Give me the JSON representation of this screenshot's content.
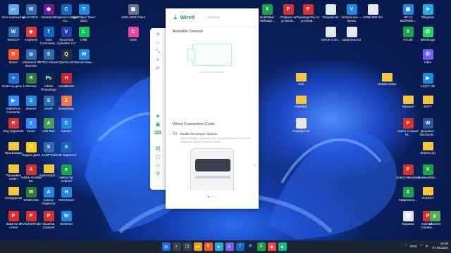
{
  "desktop": {
    "icons": [
      {
        "label": "Этот компьютер",
        "color": "#5aa9e6",
        "glyph": "▭"
      },
      {
        "label": "WinSCP",
        "color": "#2b6cb0",
        "glyph": "W"
      },
      {
        "label": "Brave",
        "color": "#fb542b",
        "glyph": "B"
      },
      {
        "label": "План на день 1",
        "color": "#1f6fd1",
        "glyph": "≡"
      },
      {
        "label": "VideoProc Converter",
        "color": "#2d8cff",
        "glyph": "▶"
      },
      {
        "label": "Reg Organizer",
        "color": "#d6302f",
        "glyph": "R"
      },
      {
        "label": "Программы",
        "color": "#f5c542",
        "glyph": ""
      },
      {
        "label": "Прошивка UNIFI",
        "color": "#f5c542",
        "glyph": ""
      },
      {
        "label": "Сотрудники",
        "color": "#f5c542",
        "glyph": ""
      },
      {
        "label": "Заметки в стиле",
        "color": "#d6302f",
        "glyph": "P"
      },
      {
        "label": "win-6-2018...",
        "color": "#2b6cb0",
        "glyph": "W"
      },
      {
        "label": "AnyDesk",
        "color": "#e53935",
        "glyph": "◆"
      },
      {
        "label": "Advanced IP Scanner",
        "color": "#2b6cb0",
        "glyph": "◎"
      },
      {
        "label": "Recuva",
        "color": "#2e7d32",
        "glyph": "R"
      },
      {
        "label": "ShareX",
        "color": "#1e88e5",
        "glyph": "S"
      },
      {
        "label": "Zoom",
        "color": "#2d8cff",
        "glyph": "Z"
      },
      {
        "label": "Яндекс Диск",
        "color": "#ffcc00",
        "glyph": "Я"
      },
      {
        "label": "Adobe Acrobat DC",
        "color": "#d6302f",
        "glyph": "A"
      },
      {
        "label": "WinDirStat",
        "color": "#2e7d32",
        "glyph": "W"
      },
      {
        "label": "RVSchetFinder",
        "color": "#d6302f",
        "glyph": "P"
      },
      {
        "label": "Wormhole",
        "color": "#6a1b9a",
        "glyph": "◉"
      },
      {
        "label": "Total Command...",
        "color": "#1565c0",
        "glyph": "T"
      },
      {
        "label": "STDU Viewer",
        "color": "#2b6cb0",
        "glyph": "S"
      },
      {
        "label": "Adobe Photoshop",
        "color": "#0b2a4a",
        "glyph": "Ps"
      },
      {
        "label": "SADP",
        "color": "#2b6cb0",
        "glyph": "S"
      },
      {
        "label": "Adb Run",
        "color": "#43a047",
        "glyph": "A"
      },
      {
        "label": "SADPTool",
        "color": "#2b6cb0",
        "glyph": "S"
      },
      {
        "label": "mysmartph...",
        "color": "#f5c542",
        "glyph": ""
      },
      {
        "label": "Autorun Organizer",
        "color": "#1e88e5",
        "glyph": "A"
      },
      {
        "label": "Ошибка страхов",
        "color": "#d6302f",
        "glyph": "P"
      },
      {
        "label": "Capsium Image Co...",
        "color": "#1565c0",
        "glyph": "C"
      },
      {
        "label": "VirusTotal Uploader 2.2",
        "color": "#1e40af",
        "glyph": "V"
      },
      {
        "label": "QuickLook",
        "color": "#263238",
        "glyph": "Q"
      },
      {
        "label": "HandBrake",
        "color": "#c62828",
        "glyph": "H"
      },
      {
        "label": "Everything",
        "color": "#ff7043",
        "glyph": "E"
      },
      {
        "label": "Сапасс",
        "color": "#1e88e5",
        "glyph": "C"
      },
      {
        "label": "Soft Organizer",
        "color": "#1565c0",
        "glyph": "S"
      },
      {
        "label": "eaKey for Android",
        "color": "#16a34a",
        "glyph": "e"
      },
      {
        "label": "HDCleaner",
        "color": "#1e88e5",
        "glyph": "H"
      },
      {
        "label": "WebIntel",
        "color": "#1e88e5",
        "glyph": "W"
      },
      {
        "label": "МойОфис Текст 2022",
        "color": "#1e88e5",
        "glyph": "T"
      },
      {
        "label": "LINE",
        "color": "#06c755",
        "glyph": "L"
      },
      {
        "label": "Экосистема...",
        "color": "#1e88e5",
        "glyph": "W"
      },
      {
        "label": "ANR-4200 Client",
        "color": "#6b7280",
        "glyph": "▦"
      },
      {
        "label": "CMS",
        "color": "#ec4899",
        "glyph": "C"
      },
      {
        "label": "МойОфис Таблица...",
        "color": "#16a34a",
        "glyph": "X"
      },
      {
        "label": "Пофикс на установ...",
        "color": "#d6302f",
        "glyph": "P"
      },
      {
        "label": "Руководство по установ...",
        "color": "#d6302f",
        "glyph": "P"
      },
      {
        "label": "Покупки.txt",
        "color": "#e5e7eb",
        "glyph": "≡"
      },
      {
        "label": "Victoria.exe — ярлык",
        "color": "#1e88e5",
        "glyph": "V"
      },
      {
        "label": "HDMI 60m.txt",
        "color": "#e5e7eb",
        "glyph": "≡"
      },
      {
        "label": "nvKun-3.18...",
        "color": "#e5e7eb",
        "glyph": "≡"
      },
      {
        "label": "Шаблоны.txt",
        "color": "#e5e7eb",
        "glyph": "≡"
      },
      {
        "label": "Sub",
        "color": "#f5c542",
        "glyph": ""
      },
      {
        "label": "Серебро",
        "color": "#f5c542",
        "glyph": ""
      },
      {
        "label": "Серебро.txt",
        "color": "#e5e7eb",
        "glyph": "≡"
      },
      {
        "label": "HP L1 MZ3RMZ...",
        "color": "#1e88e5",
        "glyph": "▦"
      },
      {
        "label": "Telegram",
        "color": "#29a9eb",
        "glyph": "➤"
      },
      {
        "label": "NTLife",
        "color": "#16a34a",
        "glyph": "X"
      },
      {
        "label": "WhatsApp",
        "color": "#25d366",
        "glyph": "✆"
      },
      {
        "label": "Viber",
        "color": "#7360f2",
        "glyph": "✆"
      },
      {
        "label": "Новая папка",
        "color": "#f5c542",
        "glyph": ""
      },
      {
        "label": "AnyTV 3D",
        "color": "#1e88e5",
        "glyph": "▶"
      },
      {
        "label": "Музыка",
        "color": "#f5c542",
        "glyph": ""
      },
      {
        "label": "SOFT",
        "color": "#f5c542",
        "glyph": ""
      },
      {
        "label": "Документ Microsoft...",
        "color": "#2b579a",
        "glyph": "W"
      },
      {
        "label": "scan1 Старый М...",
        "color": "#d6302f",
        "glyph": "P"
      },
      {
        "label": "ShareX (2)",
        "color": "#f5c542",
        "glyph": ""
      },
      {
        "label": "scan2 Николаев",
        "color": "#d6302f",
        "glyph": "P"
      },
      {
        "label": "Компьютер...",
        "color": "#16a34a",
        "glyph": "X"
      },
      {
        "label": "ALEXEY",
        "color": "#f5c542",
        "glyph": ""
      },
      {
        "label": "Кварплата...",
        "color": "#16a34a",
        "glyph": "X"
      },
      {
        "label": "Android... Справк...",
        "color": "#d6302f",
        "glyph": "P"
      },
      {
        "label": "Корзина",
        "color": "#e5e7eb",
        "glyph": "🗑"
      },
      {
        "label": "uTorrent",
        "color": "#4caf50",
        "glyph": "μ"
      }
    ]
  },
  "app": {
    "tabs": {
      "active": "Wired",
      "inactive": "Wireless"
    },
    "available_title": "Available Devices",
    "no_device": "No device found yet",
    "guide_title": "Wired Connection Guide",
    "step_number": "01",
    "step_title": "Enable Developer Options",
    "step_desc": "Open Settings > About Phone, tap Build Number or Android Version or System Version 7 times.",
    "sidebar_icons": [
      "close-icon",
      "minimize-icon",
      "pin-icon",
      "mirror-icon",
      "screen-icon",
      "rotate-icon",
      "more-icon"
    ],
    "accent": "#16a34a"
  },
  "taskbar": {
    "lang": "ENG",
    "time": "16:30",
    "date": "07.08.2023"
  }
}
